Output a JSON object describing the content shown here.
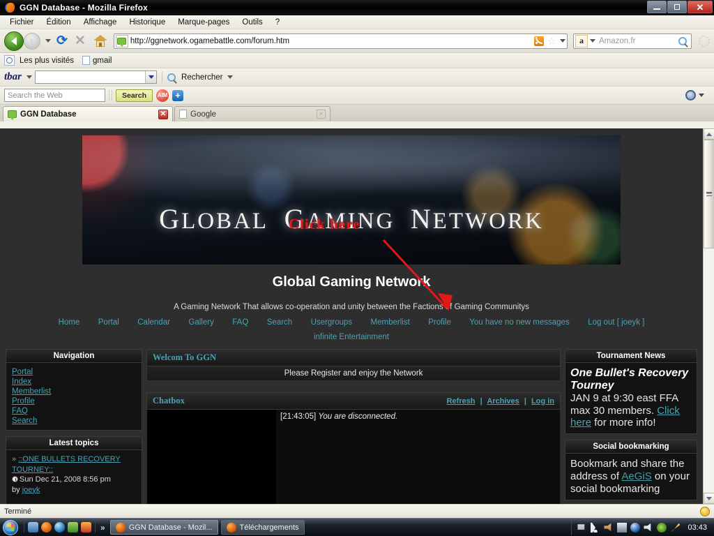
{
  "window": {
    "title": "GGN Database - Mozilla Firefox",
    "minimize": "–",
    "maximize": "□",
    "close": "✕"
  },
  "menubar": [
    {
      "label": "Fichier"
    },
    {
      "label": "Édition"
    },
    {
      "label": "Affichage"
    },
    {
      "label": "Historique"
    },
    {
      "label": "Marque-pages"
    },
    {
      "label": "Outils"
    },
    {
      "label": "?"
    }
  ],
  "navbar": {
    "back_icon": "back-arrow-icon",
    "forward_icon": "forward-arrow-icon",
    "reload_icon": "reload-icon",
    "stop_icon": "stop-icon",
    "home_icon": "home-icon",
    "url": "http://ggnetwork.ogamebattle.com/forum.htm",
    "feed_icon": "rss-feed-icon",
    "bookmark_icon": "star-bookmark-icon",
    "search_engine": "a",
    "search_placeholder": "Amazon.fr",
    "search_icon": "magnifier-icon"
  },
  "bookmarks_bar": [
    {
      "label": "Les plus visités",
      "icon": "most-visited-icon"
    },
    {
      "label": "gmail",
      "icon": "page-icon"
    }
  ],
  "tbar_toolbar": {
    "logo": "tbar",
    "input_value": "",
    "search_label": "Rechercher"
  },
  "aim_toolbar": {
    "web_placeholder": "Search the Web",
    "search_button": "Search",
    "aim_icon": "aim-icon",
    "plus_icon": "plus-icon",
    "gear_icon": "gear-icon"
  },
  "tabs": [
    {
      "label": "GGN Database",
      "active": true,
      "favicon": "chat-bubble-icon",
      "close": "✕"
    },
    {
      "label": "Google",
      "active": false,
      "favicon": "page-icon",
      "close": "✕"
    }
  ],
  "page": {
    "banner": {
      "logo_text": "GLOBAL GAMING NETWORK",
      "annotation": "Click here",
      "annotation_color": "#d81f1f"
    },
    "site_title": "Global Gaming Network",
    "site_subtitle": "A Gaming Network That allows co-operation and unity between the Factions of Gaming Communitys",
    "nav_links": [
      "Home",
      "Portal",
      "Calendar",
      "Gallery",
      "FAQ",
      "Search",
      "Usergroups",
      "Memberlist",
      "Profile",
      "You have no new messages",
      "Log out [ joeyk ]"
    ],
    "nav_links_second_row": [
      "infinite Entertainment"
    ],
    "left_column": {
      "navigation": {
        "title": "Navigation",
        "items": [
          "Portal",
          "Index",
          "Memberlist",
          "Profile",
          "FAQ",
          "Search"
        ]
      },
      "latest_topics": {
        "title": "Latest topics",
        "items": [
          {
            "bullet": "»",
            "link": "::ONE BULLETS RECOVERY TOURNEY::",
            "date": "Sun Dec 21, 2008 8:56 pm",
            "by_label": "by",
            "author": "joeyk"
          }
        ]
      }
    },
    "middle_column": {
      "welcome": {
        "title": "Welcom To GGN",
        "message": "Please Register and enjoy the Network"
      },
      "chatbox": {
        "title": "Chatbox",
        "links": [
          "Refresh",
          "Archives",
          "Log in"
        ],
        "separator": "|",
        "message_time": "[21:43:05]",
        "message_text": "You are disconnected."
      }
    },
    "right_column": {
      "tournament_news": {
        "title": "Tournament News",
        "headline": "One Bullet's Recovery Tourney",
        "body_before_link": "JAN 9 at 9:30 east FFA max 30 members. ",
        "link": "Click here",
        "body_after_link": " for more info!"
      },
      "social_bookmarking": {
        "title": "Social bookmarking",
        "text_before_link": "Bookmark and share the address of ",
        "link": "AeGiS",
        "text_after_link": " on your social bookmarking"
      }
    },
    "colors": {
      "link": "#4aa3b5",
      "page_bg": "#2e2e2e",
      "panel_bg": "#121212"
    }
  },
  "scrollbar": {
    "up_arrow": "scroll-up-icon",
    "down_arrow": "scroll-down-icon"
  },
  "statusbar": {
    "text": "Terminé",
    "icon": "smiley-icon"
  },
  "taskbar": {
    "start": "start-orb-icon",
    "quicklaunch": [
      "show-desktop-icon",
      "firefox-icon",
      "msn-icon",
      "media-icon",
      "flash-icon"
    ],
    "overflow": "»",
    "buttons": [
      {
        "label": "GGN Database - Mozil...",
        "active": true,
        "icon": "firefox-icon"
      },
      {
        "label": "Téléchargements",
        "active": false,
        "icon": "firefox-icon"
      }
    ],
    "tray": [
      "network-disconnected-icon",
      "wireless-icon",
      "speaker-muted-icon",
      "screen-icon",
      "ie-icon",
      "volume-icon",
      "nvidia-icon",
      "pen-icon"
    ],
    "clock": "03:43"
  }
}
